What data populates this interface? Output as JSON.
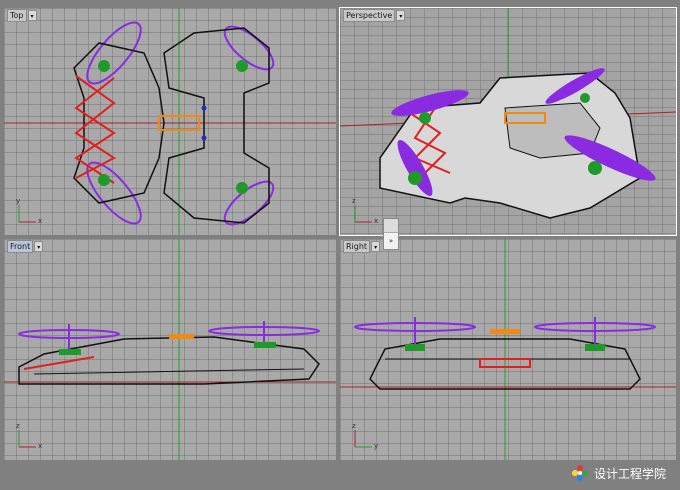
{
  "viewports": {
    "top": {
      "label": "Top",
      "dropdown_glyph": "▾"
    },
    "perspective": {
      "label": "Perspective",
      "dropdown_glyph": "▾"
    },
    "front": {
      "label": "Front",
      "dropdown_glyph": "▾"
    },
    "right": {
      "label": "Right",
      "dropdown_glyph": "▾"
    }
  },
  "axis_labels": {
    "x": "x",
    "y": "y",
    "z": "z"
  },
  "mini_button": {
    "glyph": "»"
  },
  "watermark": {
    "text": "设计工程学院"
  },
  "colors": {
    "viewport_bg": "#a9a9a9",
    "grid": "#8f8f8f",
    "x_axis": "#b02020",
    "y_axis": "#2a9a2a",
    "wireframe": "#111111",
    "propeller": "#8a2be2",
    "frame_red": "#e02020",
    "battery_orange": "#f08a10",
    "motor_green": "#1f9a2a",
    "screw_blue": "#2030c0"
  }
}
